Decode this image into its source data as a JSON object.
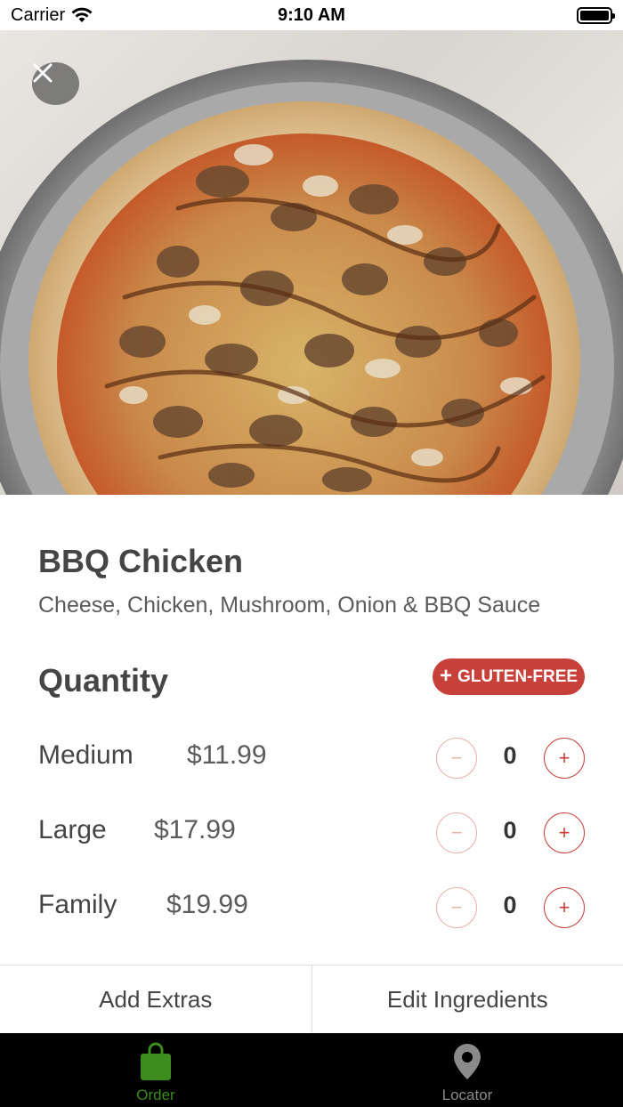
{
  "status_bar": {
    "carrier": "Carrier",
    "time": "9:10 AM"
  },
  "hero": {
    "image": "bbq-chicken-pizza-photo"
  },
  "item": {
    "title": "BBQ Chicken",
    "description": "Cheese, Chicken, Mushroom, Onion & BBQ Sauce"
  },
  "quantity": {
    "title": "Quantity",
    "gluten_free_label": "GLUTEN-FREE",
    "sizes": [
      {
        "name": "Medium",
        "price": "$11.99",
        "count": "0"
      },
      {
        "name": "Large",
        "price": "$17.99",
        "count": "0"
      },
      {
        "name": "Family",
        "price": "$19.99",
        "count": "0"
      }
    ]
  },
  "actions": {
    "add_extras": "Add Extras",
    "edit_ingredients": "Edit Ingredients"
  },
  "tabs": [
    {
      "label": "Order",
      "icon": "shopping-bag-icon",
      "active": true
    },
    {
      "label": "Locator",
      "icon": "map-pin-icon",
      "active": false
    }
  ],
  "colors": {
    "accent": "#c8403a",
    "tab_active": "#3d8c1e",
    "tab_bar": "#000000"
  }
}
